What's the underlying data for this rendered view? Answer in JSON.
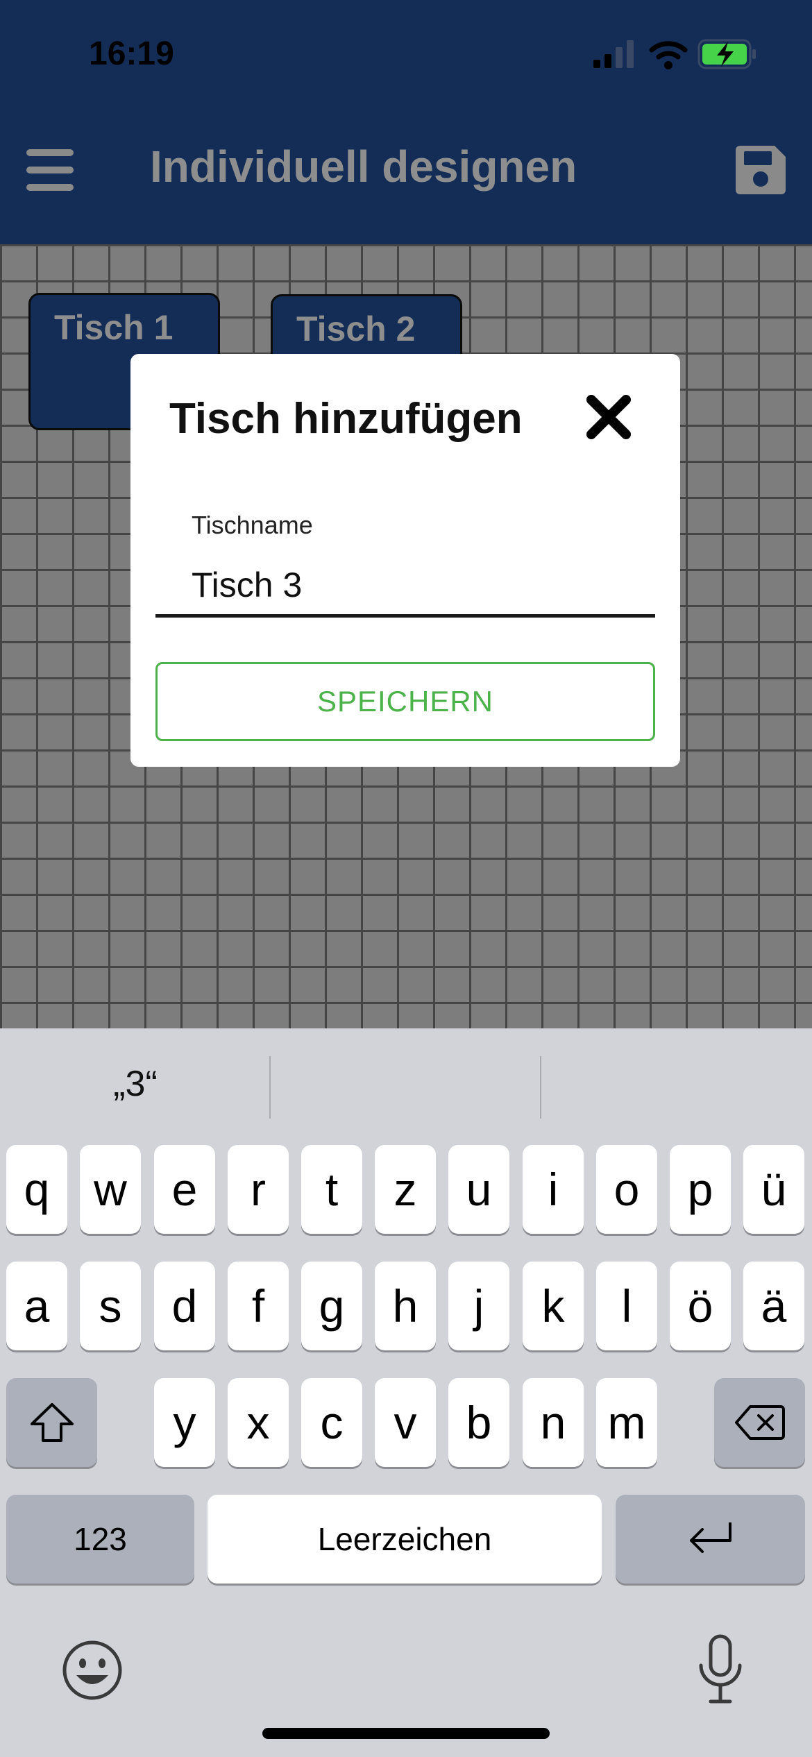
{
  "status_bar": {
    "time": "16:19"
  },
  "header": {
    "title": "Individuell designen"
  },
  "canvas": {
    "tables": [
      {
        "label": "Tisch 1"
      },
      {
        "label": "Tisch 2"
      }
    ]
  },
  "dialog": {
    "title": "Tisch hinzufügen",
    "field_label": "Tischname",
    "field_value": "Tisch 3",
    "save_label": "SPEICHERN"
  },
  "keyboard": {
    "suggestions": [
      "„3“",
      "",
      ""
    ],
    "row1": [
      "q",
      "w",
      "e",
      "r",
      "t",
      "z",
      "u",
      "i",
      "o",
      "p",
      "ü"
    ],
    "row2": [
      "a",
      "s",
      "d",
      "f",
      "g",
      "h",
      "j",
      "k",
      "l",
      "ö",
      "ä"
    ],
    "row3": [
      "y",
      "x",
      "c",
      "v",
      "b",
      "n",
      "m"
    ],
    "numbers_label": "123",
    "space_label": "Leerzeichen"
  },
  "colors": {
    "header_bg": "#132d57",
    "accent_green": "#4cb24a",
    "battery_green": "#46d34a"
  }
}
